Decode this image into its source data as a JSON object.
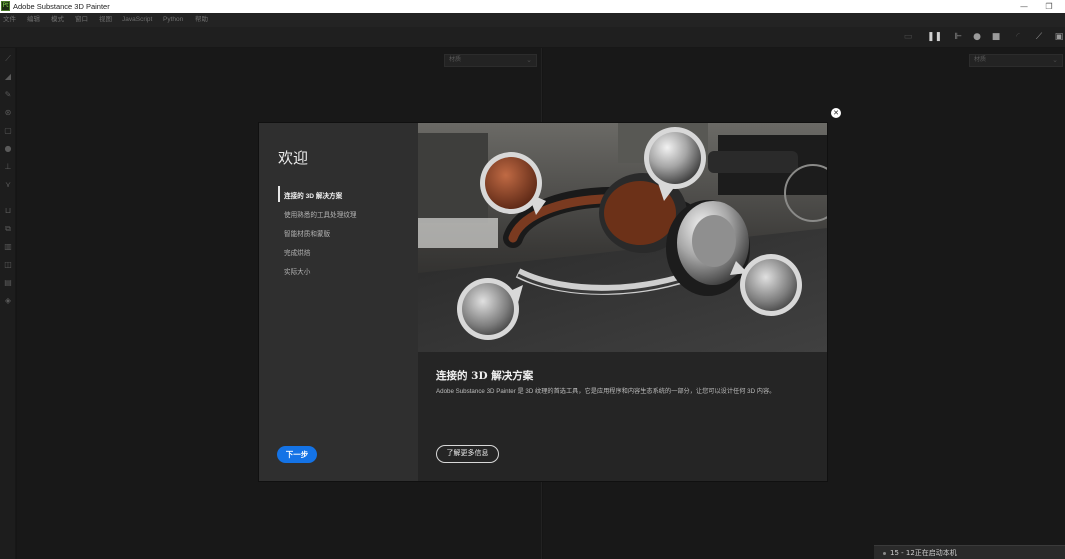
{
  "window": {
    "title": "Adobe Substance 3D Painter",
    "logo_text": "Pt",
    "minimize_glyph": "—",
    "restore_glyph": "❐"
  },
  "menu": [
    "文件",
    "编辑",
    "模式",
    "窗口",
    "视图",
    "JavaScript",
    "Python",
    "帮助"
  ],
  "viewports": {
    "left_select": "材质",
    "right_select": "材质"
  },
  "toolbar_icons": [
    "grid-icon",
    "pause-icon",
    "symmetry-icon",
    "sphere-icon",
    "camera-icon",
    "light-icon",
    "brush-icon",
    "screenshot-icon"
  ],
  "left_tools": [
    "paint-icon",
    "eraser-icon",
    "projection-icon",
    "geometry-fill-icon",
    "smudge-icon",
    "clone-icon",
    "material-picker-icon",
    "bake-icon",
    "export-icon",
    "layers-icon",
    "texture-set-icon",
    "display-icon",
    "log-icon",
    "shelf-icon"
  ],
  "dialog": {
    "title": "欢迎",
    "nav_items": [
      {
        "label": "连接的 3D 解决方案",
        "active": true
      },
      {
        "label": "使用熟悉的工具处理纹理",
        "active": false
      },
      {
        "label": "智能材质和蒙版",
        "active": false
      },
      {
        "label": "完成烘焙",
        "active": false
      },
      {
        "label": "实际大小",
        "active": false
      }
    ],
    "next_button": "下一步",
    "content": {
      "title": "连接的 3D 解决方案",
      "body": "Adobe Substance 3D Painter 是 3D 纹理的首选工具，它是应用程序和内容生态系统的一部分，让您可以设计任何 3D 内容。",
      "learn_more": "了解更多信息"
    },
    "close_glyph": "✕"
  },
  "notification": "15 - 12正在启动本机",
  "colors": {
    "accent": "#1473e6",
    "background": "#151515",
    "dialog_bg": "#252525",
    "sidebar_bg": "#2f2f2f"
  }
}
